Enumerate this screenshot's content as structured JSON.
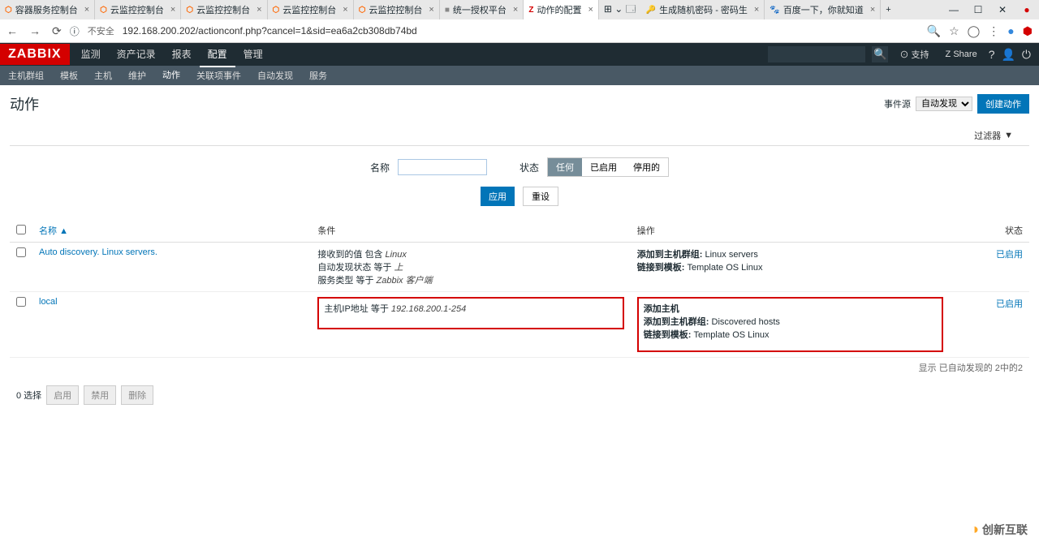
{
  "browser": {
    "tabs": [
      {
        "label": "容器服务控制台",
        "icon": "orange"
      },
      {
        "label": "云监控控制台",
        "icon": "orange"
      },
      {
        "label": "云监控控制台",
        "icon": "orange"
      },
      {
        "label": "云监控控制台",
        "icon": "orange"
      },
      {
        "label": "云监控控制台",
        "icon": "orange"
      },
      {
        "label": "统一授权平台",
        "icon": "grey"
      },
      {
        "label": "动作的配置",
        "icon": "red",
        "active": true
      },
      {
        "label": "生成随机密码 - 密码生",
        "icon": "blue"
      },
      {
        "label": "百度一下，你就知道",
        "icon": "blue"
      }
    ],
    "security": "不安全",
    "url": "192.168.200.202/actionconf.php?cancel=1&sid=ea6a2cb308db74bd"
  },
  "header": {
    "logo": "ZABBIX",
    "nav": [
      "监测",
      "资产记录",
      "报表",
      "配置",
      "管理"
    ],
    "nav_active": 3,
    "support": "支持",
    "share": "Share"
  },
  "subnav": {
    "items": [
      "主机群组",
      "模板",
      "主机",
      "维护",
      "动作",
      "关联项事件",
      "自动发现",
      "服务"
    ],
    "active": 4
  },
  "page": {
    "title": "动作",
    "event_source_label": "事件源",
    "event_source_value": "自动发现",
    "create_btn": "创建动作"
  },
  "filter": {
    "tab_label": "过滤器",
    "name_label": "名称",
    "name_value": "",
    "status_label": "状态",
    "status_options": [
      "任何",
      "已启用",
      "停用的"
    ],
    "status_active": 0,
    "apply_btn": "应用",
    "reset_btn": "重设"
  },
  "table": {
    "headers": {
      "name": "名称",
      "condition": "条件",
      "operation": "操作",
      "status": "状态"
    },
    "sort_indicator": "▲",
    "rows": [
      {
        "name": "Auto discovery. Linux servers.",
        "condition_lines": [
          {
            "label": "接收到的值 包含 ",
            "value": "Linux"
          },
          {
            "label": "自动发现状态 等于 ",
            "value": "上"
          },
          {
            "label": "服务类型 等于 ",
            "value": "Zabbix 客户端"
          }
        ],
        "operation_lines": [
          {
            "label": "添加到主机群组: ",
            "value": "Linux servers"
          },
          {
            "label": "链接到模板: ",
            "value": "Template OS Linux"
          }
        ],
        "status": "已启用",
        "highlight": false
      },
      {
        "name": "local",
        "condition_lines": [
          {
            "label": "主机IP地址 等于 ",
            "value": "192.168.200.1-254"
          }
        ],
        "operation_lines": [
          {
            "label": "添加主机",
            "value": ""
          },
          {
            "label": "添加到主机群组: ",
            "value": "Discovered hosts"
          },
          {
            "label": "链接到模板: ",
            "value": "Template OS Linux"
          }
        ],
        "status": "已启用",
        "highlight": true
      }
    ],
    "display_info": "显示 已自动发现的 2中的2"
  },
  "footer": {
    "selected": "0 选择",
    "btns": [
      "启用",
      "禁用",
      "删除"
    ]
  },
  "watermark": "创新互联"
}
